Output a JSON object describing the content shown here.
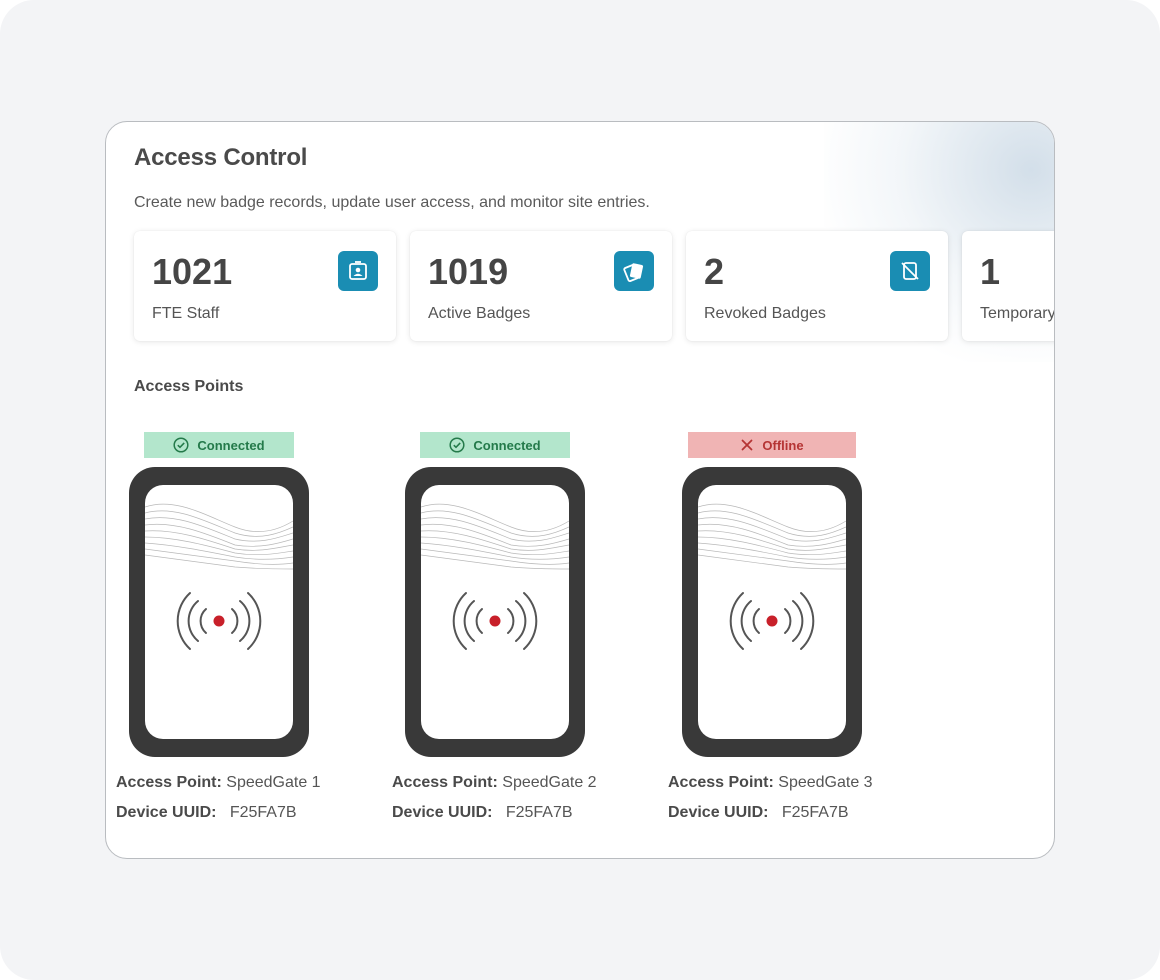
{
  "page": {
    "title": "Access Control",
    "subtitle": "Create new badge records, update user access, and monitor site entries."
  },
  "stats": [
    {
      "value": "1021",
      "label": "FTE Staff",
      "icon": "id-badge-icon"
    },
    {
      "value": "1019",
      "label": "Active Badges",
      "icon": "badge-cards-icon"
    },
    {
      "value": "2",
      "label": "Revoked Badges",
      "icon": "revoked-badge-icon"
    },
    {
      "value": "1",
      "label": "Temporary",
      "icon": "temporary-badge-icon"
    }
  ],
  "access_points_section": {
    "title": "Access Points",
    "access_point_label": "Access Point:",
    "uuid_label": "Device UUID:",
    "items": [
      {
        "status": "Connected",
        "status_icon": "check-circle-icon",
        "name": "SpeedGate 1",
        "uuid": "F25FA7B"
      },
      {
        "status": "Connected",
        "status_icon": "check-circle-icon",
        "name": "SpeedGate 2",
        "uuid": "F25FA7B"
      },
      {
        "status": "Offline",
        "status_icon": "close-icon",
        "name": "SpeedGate 3",
        "uuid": "F25FA7B"
      }
    ]
  },
  "colors": {
    "accent": "#1a8db3",
    "connected_bg": "#b3e6cc",
    "connected_text": "#247a4a",
    "offline_bg": "#f0b4b4",
    "offline_text": "#b53434",
    "device_body": "#393939",
    "rfid_dot": "#c8202a"
  }
}
